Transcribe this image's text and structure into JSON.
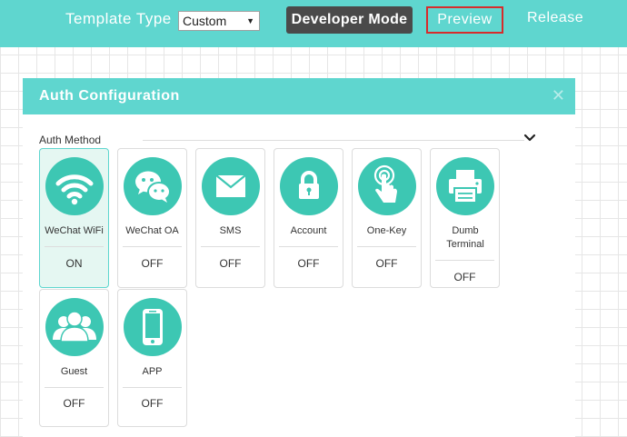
{
  "topbar": {
    "template_type_label": "Template Type",
    "template_select_value": "Custom",
    "developer_mode_label": "Developer Mode",
    "preview_label": "Preview",
    "release_label": "Release"
  },
  "panel": {
    "title": "Auth Configuration",
    "close_glyph": "✕",
    "section_label": "Auth Method"
  },
  "methods": [
    {
      "name": "WeChat WiFi",
      "status": "ON",
      "icon": "wifi-icon"
    },
    {
      "name": "WeChat OA",
      "status": "OFF",
      "icon": "wechat-icon"
    },
    {
      "name": "SMS",
      "status": "OFF",
      "icon": "envelope-icon"
    },
    {
      "name": "Account",
      "status": "OFF",
      "icon": "lock-icon"
    },
    {
      "name": "One-Key",
      "status": "OFF",
      "icon": "tap-icon"
    },
    {
      "name": "Dumb Terminal",
      "status": "OFF",
      "icon": "printer-icon"
    },
    {
      "name": "Guest",
      "status": "OFF",
      "icon": "users-icon"
    },
    {
      "name": "APP",
      "status": "OFF",
      "icon": "phone-icon"
    }
  ],
  "colors": {
    "accent": "#5fd6cf",
    "icon_bg": "#3dc7b3",
    "selected_bg": "#e5f7f2",
    "preview_border": "#d62b2b",
    "dev_button_bg": "#4a4a4a"
  }
}
